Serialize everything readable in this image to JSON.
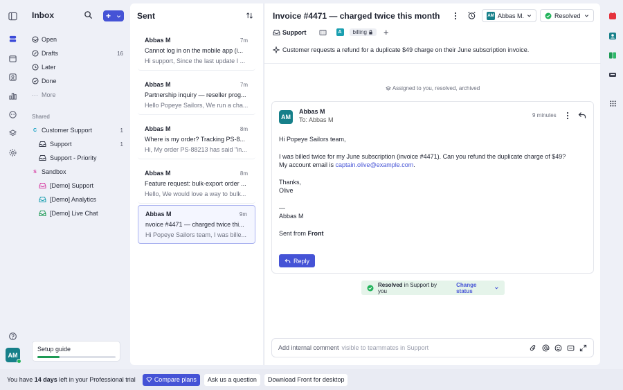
{
  "inbox": {
    "title": "Inbox",
    "nav": [
      {
        "label": "Open",
        "count": ""
      },
      {
        "label": "Drafts",
        "count": "16"
      },
      {
        "label": "Later",
        "count": ""
      },
      {
        "label": "Done",
        "count": ""
      },
      {
        "label": "More",
        "count": ""
      }
    ],
    "shared_label": "Shared",
    "shared": [
      {
        "label": "Customer Support",
        "count": "1",
        "letter": "C"
      },
      {
        "label": "Support",
        "count": "1"
      },
      {
        "label": "Support - Priority",
        "count": ""
      },
      {
        "label": "Sandbox",
        "count": "",
        "letter": "S"
      },
      {
        "label": "[Demo] Support",
        "count": ""
      },
      {
        "label": "[Demo] Analytics",
        "count": ""
      },
      {
        "label": "[Demo] Live Chat",
        "count": ""
      }
    ],
    "setup_guide": "Setup guide",
    "setup_progress": 0.28
  },
  "user": {
    "initials": "AM"
  },
  "sent": {
    "title": "Sent",
    "items": [
      {
        "from": "Abbas M",
        "time": "7m",
        "subject": "Cannot log in on the mobile app (i...",
        "preview": "Hi support, Since the last update I ..."
      },
      {
        "from": "Abbas M",
        "time": "7m",
        "subject": "Partnership inquiry — reseller prog...",
        "preview": "Hello Popeye Sailors, We run a cha..."
      },
      {
        "from": "Abbas M",
        "time": "8m",
        "subject": "Where is my order? Tracking PS-8...",
        "preview": "Hi, My order PS-88213 has said \"in..."
      },
      {
        "from": "Abbas M",
        "time": "8m",
        "subject": "Feature request: bulk-export order ...",
        "preview": "Hello, We would love a way to bulk..."
      },
      {
        "from": "Abbas M",
        "time": "9m",
        "subject": "nvoice #4471 — charged twice thi...",
        "preview": "Hi Popeye Sailors team, I was bille..."
      }
    ]
  },
  "conversation": {
    "title": "Invoice #4471 — charged twice this month",
    "assignee": "Abbas M.",
    "assignee_initials": "AM",
    "status_button": "Resolved",
    "inbox_tag": "Support",
    "tag_letter": "A",
    "tag": "billing",
    "summary": "Customer requests a refund for a duplicate $49 charge on their June subscription invoice.",
    "assigned_note": "Assigned to you, resolved, archived",
    "message": {
      "avatar": "AM",
      "from": "Abbas M",
      "to": "To: Abbas M",
      "time": "9 minutes",
      "greeting": "Hi Popeye Sailors team,",
      "line1": "I was billed twice for my June subscription (invoice #4471). Can you refund the duplicate charge of $49?",
      "line2_prefix": "My account email is ",
      "email": "captain.olive@example.com",
      "line2_suffix": ".",
      "thanks": "Thanks,",
      "signoff_name": "Olive",
      "dash": "—",
      "sig": "Abbas M",
      "sent_from": "Sent from ",
      "sent_from_brand": "Front",
      "reply_label": "Reply"
    },
    "status_bar": {
      "bold": "Resolved",
      "rest": " in Support by you",
      "link": "Change status"
    },
    "composer": {
      "placeholder": "Add internal comment",
      "hint": "visible to teammates in Support"
    }
  },
  "trial": {
    "prefix": "You have ",
    "days": "14 days",
    "suffix": " left in your Professional trial",
    "compare": "Compare plans",
    "ask": "Ask us a question",
    "download": "Download Front for desktop"
  },
  "colors": {
    "accent": "#4553d6",
    "green": "#22b35b",
    "teal": "#17808a"
  }
}
